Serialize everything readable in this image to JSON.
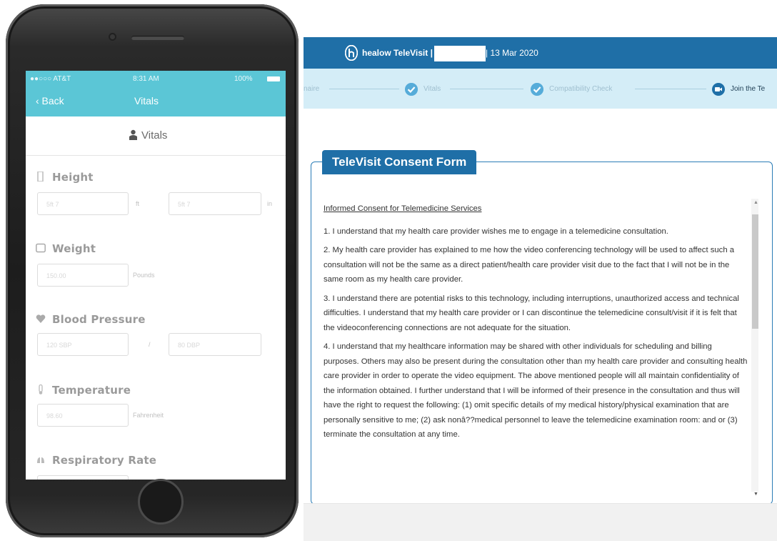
{
  "phone": {
    "status": {
      "carrier": "●●○○○ AT&T",
      "time": "8:31 AM",
      "battery": "100%"
    },
    "nav": {
      "back": "‹ Back",
      "title": "Vitals"
    },
    "header": "Vitals",
    "sections": [
      {
        "label": "Height",
        "icon": "ruler-icon",
        "fields": [
          "5ft 7",
          "5ft 7"
        ],
        "units": [
          "ft",
          "in"
        ]
      },
      {
        "label": "Weight",
        "icon": "scale-icon",
        "fields": [
          "150.00"
        ],
        "units": [
          "Pounds"
        ]
      },
      {
        "label": "Blood Pressure",
        "icon": "heart-icon",
        "fields": [
          "120 SBP",
          "80 DBP"
        ],
        "units": [
          "/"
        ]
      },
      {
        "label": "Temperature",
        "icon": "thermometer-icon",
        "fields": [
          "98.60"
        ],
        "units": [
          "Fahrenheit"
        ]
      },
      {
        "label": "Respiratory Rate",
        "icon": "lungs-icon",
        "fields": [],
        "units": []
      }
    ]
  },
  "app": {
    "brand": "healow TeleVisit |",
    "date": "| 13 Mar 2020",
    "steps": [
      {
        "label": "naire",
        "state": "partial"
      },
      {
        "label": "Vitals",
        "state": "done"
      },
      {
        "label": "Compatibility Check",
        "state": "done"
      },
      {
        "label": "Join the Te",
        "state": "current"
      }
    ],
    "form_title": "TeleVisit Consent Form",
    "consent": {
      "title": "Informed Consent for Telemedicine Services",
      "paragraphs": [
        "1. I understand that my health care provider wishes me to engage in a telemedicine consultation.",
        "2. My health care provider has explained to me how the video conferencing technology will be used to affect such a consultation will not be the same as a direct patient/health care provider visit due to the fact that I will not be in the same room as my health care provider.",
        "3. I understand there are potential risks to this technology, including interruptions, unauthorized access and technical difficulties.  I understand that my health care provider or I can discontinue the telemedicine consult/visit if it is felt that the videoconferencing connections are not adequate for the situation.",
        "4. I understand that my healthcare information may be shared with other individuals for scheduling and billing purposes.  Others may also be present during the consultation other than my health care provider and consulting health care provider in order to operate the video equipment.  The above mentioned people will all maintain confidentiality of the information obtained.  I further understand that I will be informed of their presence in the consultation and thus will have the right to request the following: (1) omit specific details of my medical history/physical examination that are personally sensitive to me; (2) ask nonâ??medical personnel to leave the telemedicine examination room: and or (3) terminate the consultation at any time."
      ]
    },
    "colors": {
      "topbar": "#1f6fa7",
      "stepbar": "#d4edf7",
      "accent": "#56acd9"
    }
  }
}
